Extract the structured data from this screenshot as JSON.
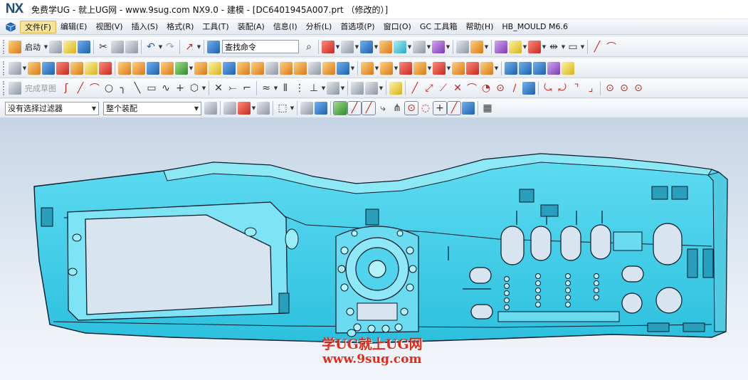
{
  "app": {
    "logo": "NX",
    "title": "免费学UG - 就上UG网 - www.9sug.com NX9.0 - 建模 - [DC6401945A007.prt （修改的）]"
  },
  "menu": {
    "items": [
      "文件(F)",
      "编辑(E)",
      "视图(V)",
      "插入(S)",
      "格式(R)",
      "工具(T)",
      "装配(A)",
      "信息(I)",
      "分析(L)",
      "首选项(P)",
      "窗口(O)",
      "GC 工具箱",
      "帮助(H)",
      "HB_MOULD M6.6"
    ]
  },
  "toolbar": {
    "start_label": "启动",
    "command_finder_value": "查找命令",
    "finish_sketch_label": "完成草图"
  },
  "selection_bar": {
    "filter_value": "没有选择过滤器",
    "scope_value": "整个装配"
  },
  "watermark": {
    "line1": "学UG就上UG网",
    "line2": "www.9sug.com"
  },
  "colors": {
    "part_fill": "#3fd0ea",
    "part_edge": "#0b1a2a",
    "watermark": "#e02b1c",
    "menu_active": "#f8e39a"
  }
}
